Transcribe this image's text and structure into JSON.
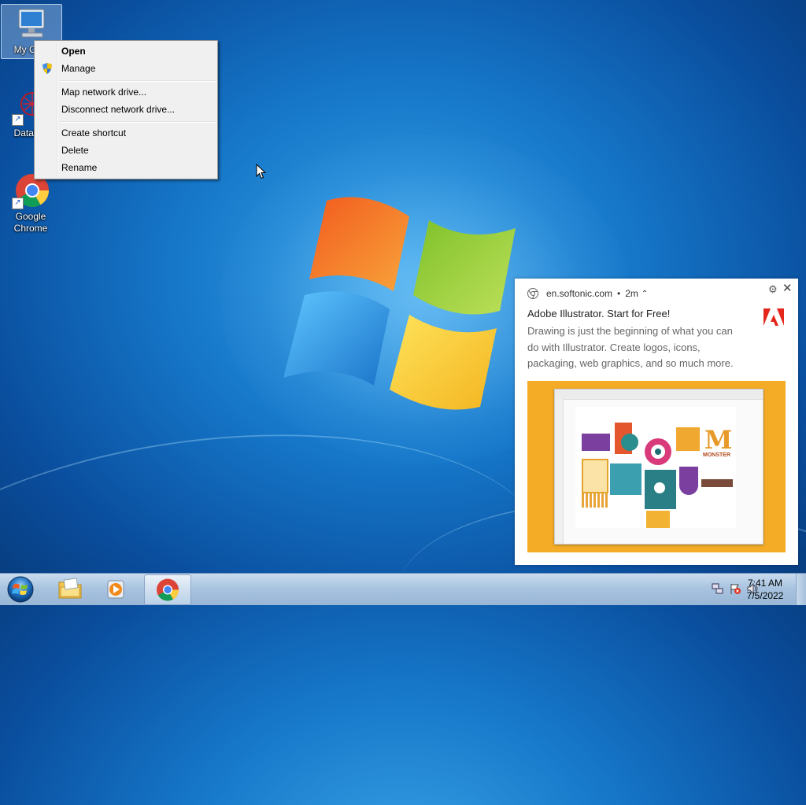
{
  "desktop": {
    "icons": [
      {
        "label": "My Com",
        "name": "my-computer"
      },
      {
        "label": "DataWa",
        "name": "datawatch"
      },
      {
        "label": "Google Chrome",
        "name": "google-chrome"
      }
    ]
  },
  "context_menu": {
    "items": [
      "Open",
      "Manage",
      "Map network drive...",
      "Disconnect network drive...",
      "Create shortcut",
      "Delete",
      "Rename"
    ]
  },
  "notification": {
    "source": "en.softonic.com",
    "time": "2m",
    "title": "Adobe Illustrator. Start for Free!",
    "body": "Drawing is just the beginning of what you can do with Illustrator. Create logos, icons, packaging, web graphics, and so much more.",
    "hero_text": "MONSTER"
  },
  "taskbar": {
    "time": "7:41 AM",
    "date": "7/5/2022"
  },
  "colors": {
    "desktop_blue": "#1677c9",
    "hero_bg": "#f4ac27",
    "adobe_red": "#e4261b"
  }
}
